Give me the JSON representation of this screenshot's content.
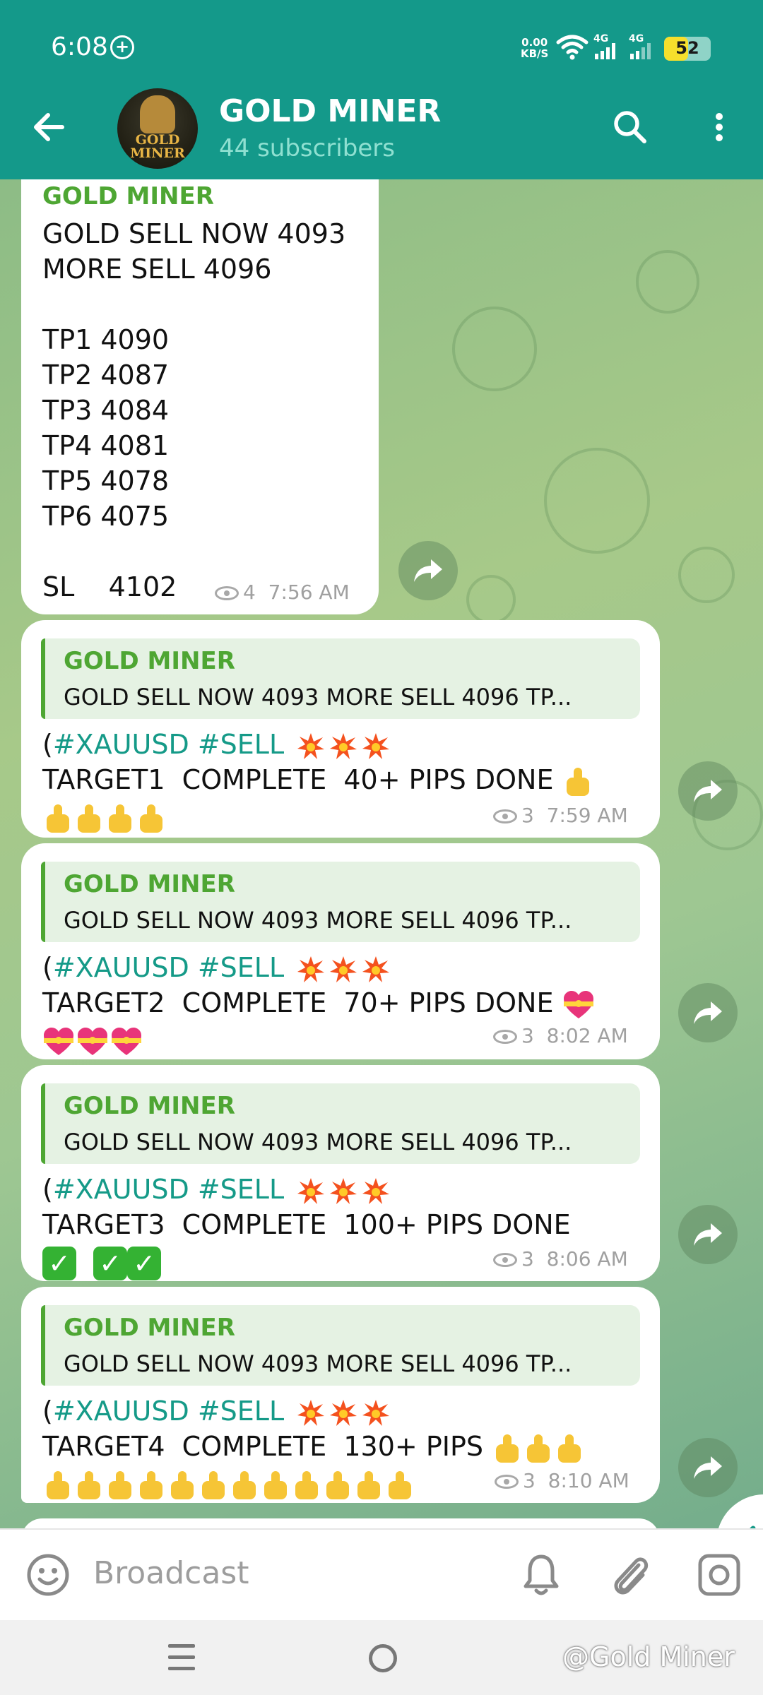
{
  "status_bar": {
    "time": "6:08",
    "net_speed_value": "0.00",
    "net_speed_unit": "KB/S",
    "signal1_label": "4G",
    "signal2_label": "4G",
    "battery": "52",
    "battery_level": 0.52
  },
  "header": {
    "title": "GOLD MINER",
    "subtitle": "44 subscribers",
    "avatar_text_line1": "GOLD",
    "avatar_text_line2": "MINER"
  },
  "colors": {
    "header_bg": "#14998a",
    "sender_green": "#4ea633",
    "hashtag_teal": "#159a88"
  },
  "messages": {
    "signal": {
      "sender": "GOLD MINER",
      "text": "GOLD SELL NOW 4093\nMORE SELL 4096\n\nTP1 4090\nTP2 4087\nTP3 4084\nTP4 4081\nTP5 4078\nTP6 4075\n\nSL    4102",
      "views": "4",
      "time": "7:56 AM"
    },
    "target1": {
      "reply_sender": "GOLD MINER",
      "reply_text": "GOLD SELL NOW 4093 MORE SELL 4096  TP...",
      "paren": "(",
      "tag1": "#XAUUSD",
      "tag2": "#SELL",
      "line": "TARGET1  COMPLETE  40+ PIPS DONE",
      "emoji_name": "thumbs-up",
      "views": "3",
      "time": "7:59 AM"
    },
    "target2": {
      "reply_sender": "GOLD MINER",
      "reply_text": "GOLD SELL NOW 4093 MORE SELL 4096  TP...",
      "paren": "(",
      "tag1": "#XAUUSD",
      "tag2": "#SELL",
      "line": "TARGET2  COMPLETE  70+ PIPS DONE",
      "emoji_name": "heart-with-ribbon",
      "views": "3",
      "time": "8:02 AM"
    },
    "target3": {
      "reply_sender": "GOLD MINER",
      "reply_text": "GOLD SELL NOW 4093 MORE SELL 4096  TP...",
      "paren": "(",
      "tag1": "#XAUUSD",
      "tag2": "#SELL",
      "line": "TARGET3  COMPLETE  100+ PIPS DONE",
      "emoji_name": "check-mark",
      "views": "3",
      "time": "8:06 AM"
    },
    "target4": {
      "reply_sender": "GOLD MINER",
      "reply_text": "GOLD SELL NOW 4093 MORE SELL 4096  TP...",
      "paren": "(",
      "tag1": "#XAUUSD",
      "tag2": "#SELL",
      "line": "TARGET4  COMPLETE  130+ PIPS",
      "emoji_name": "thumbs-up",
      "views": "3",
      "time": "8:10 AM"
    }
  },
  "input": {
    "placeholder": "Broadcast"
  },
  "watermark": "@Gold Miner"
}
